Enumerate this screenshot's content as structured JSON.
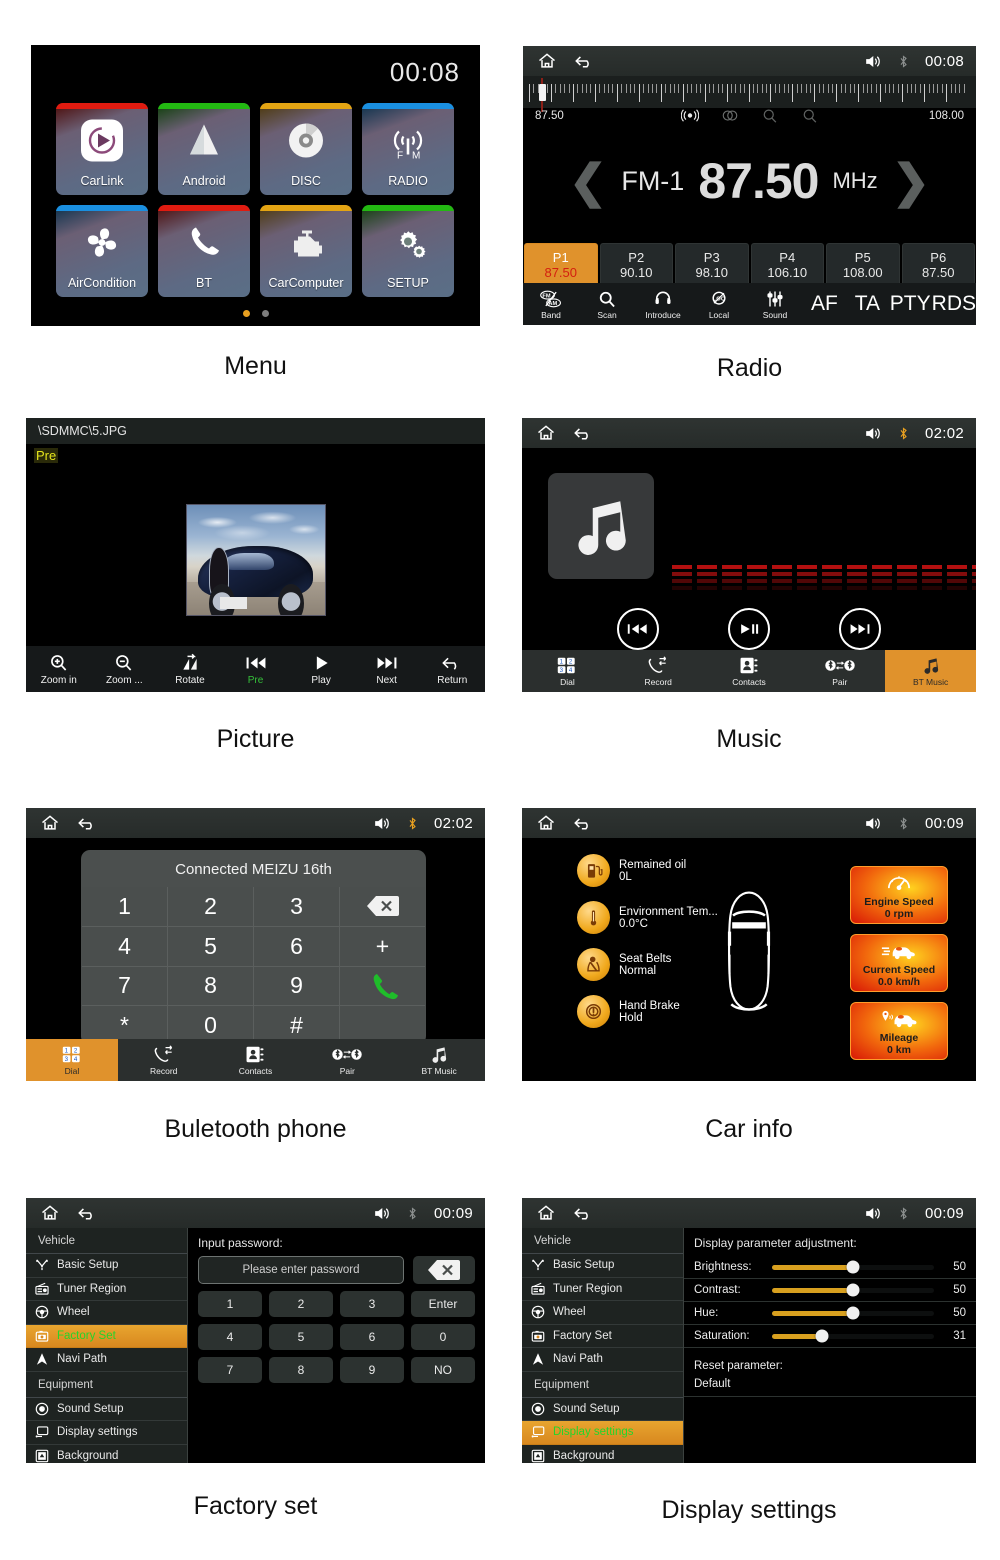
{
  "statusbar": {
    "home_icon": "home-icon",
    "back_icon": "back-arrow-icon",
    "volume_icon": "volume-icon",
    "bluetooth_icon": "bluetooth-icon"
  },
  "panels": [
    {
      "id": "menu",
      "caption": "Menu",
      "time": "00:08",
      "tiles": [
        {
          "label": "CarLink",
          "accent": "#e01b10",
          "icon": "carplay-icon"
        },
        {
          "label": "Android",
          "accent": "#23b812",
          "icon": "android-auto-icon"
        },
        {
          "label": "DISC",
          "accent": "#e3a413",
          "icon": "disc-icon"
        },
        {
          "label": "RADIO",
          "accent": "#1a8fe0",
          "icon": "radio-antenna-icon"
        },
        {
          "label": "AirCondition",
          "accent": "#1a8fe0",
          "icon": "fan-icon"
        },
        {
          "label": "BT",
          "accent": "#e01b10",
          "icon": "phone-handset-icon"
        },
        {
          "label": "CarComputer",
          "accent": "#e3a413",
          "icon": "engine-icon"
        },
        {
          "label": "SETUP",
          "accent": "#23b812",
          "icon": "gears-icon"
        }
      ],
      "page_dots": {
        "count": 2,
        "active": 0
      }
    },
    {
      "id": "radio",
      "caption": "Radio",
      "time": "00:08",
      "scale": {
        "min_label": "87.50",
        "max_label": "108.00",
        "cursor_pct": 4
      },
      "mini_icons": [
        "stereo-signal-icon",
        "stereo-icon",
        "scan-up-icon",
        "scan-down-icon"
      ],
      "band": "FM-1",
      "frequency": "87.50",
      "unit": "MHz",
      "prev_icon": "chevron-left-icon",
      "next_icon": "chevron-right-icon",
      "presets": [
        {
          "name": "P1",
          "freq": "87.50",
          "active": true
        },
        {
          "name": "P2",
          "freq": "90.10",
          "active": false
        },
        {
          "name": "P3",
          "freq": "98.10",
          "active": false
        },
        {
          "name": "P4",
          "freq": "106.10",
          "active": false
        },
        {
          "name": "P5",
          "freq": "108.00",
          "active": false
        },
        {
          "name": "P6",
          "freq": "87.50",
          "active": false
        }
      ],
      "bottom_icon_items": [
        {
          "label": "Band",
          "icon": "fm-am-icon"
        },
        {
          "label": "Scan",
          "icon": "search-icon"
        },
        {
          "label": "Introduce",
          "icon": "headphones-icon"
        },
        {
          "label": "Local",
          "icon": "loc-icon"
        },
        {
          "label": "Sound",
          "icon": "equalizer-icon"
        }
      ],
      "bottom_text_items": [
        "AF",
        "TA",
        "PTY",
        "RDS"
      ]
    },
    {
      "id": "picture",
      "caption": "Picture",
      "path": "\\SDMMC\\5.JPG",
      "overlay_label": "Pre",
      "toolbar": [
        {
          "label": "Zoom in",
          "icon": "zoom-in-icon",
          "selected": false
        },
        {
          "label": "Zoom ...",
          "icon": "zoom-out-icon",
          "selected": false
        },
        {
          "label": "Rotate",
          "icon": "rotate-icon",
          "selected": false
        },
        {
          "label": "Pre",
          "icon": "previous-icon",
          "selected": true
        },
        {
          "label": "Play",
          "icon": "play-icon",
          "selected": false
        },
        {
          "label": "Next",
          "icon": "next-icon",
          "selected": false
        },
        {
          "label": "Return",
          "icon": "return-arrow-icon",
          "selected": false
        }
      ]
    },
    {
      "id": "music",
      "caption": "Music",
      "time": "02:02",
      "album_icon": "music-note-icon",
      "equalizer": {
        "columns": 17,
        "segments": 4,
        "color": "#b31010"
      },
      "controls": [
        {
          "icon": "rewind-icon"
        },
        {
          "icon": "play-pause-icon"
        },
        {
          "icon": "fast-forward-icon"
        }
      ],
      "tabs": [
        {
          "label": "Dial",
          "icon": "keypad-icon",
          "active": false
        },
        {
          "label": "Record",
          "icon": "call-log-icon",
          "active": false
        },
        {
          "label": "Contacts",
          "icon": "contacts-book-icon",
          "active": false
        },
        {
          "label": "Pair",
          "icon": "bt-pair-icon",
          "active": false
        },
        {
          "label": "BT Music",
          "icon": "music-note-icon",
          "active": true
        }
      ]
    },
    {
      "id": "bluetooth",
      "caption": "Buletooth phone",
      "time": "02:02",
      "connected_title": "Connected MEIZU 16th",
      "keys": [
        "1",
        "2",
        "3",
        "backspace-icon",
        "4",
        "5",
        "6",
        "+",
        "7",
        "8",
        "9",
        "call-icon",
        "*",
        "0",
        "#",
        ""
      ],
      "tabs": [
        {
          "label": "Dial",
          "icon": "keypad-icon",
          "active": true
        },
        {
          "label": "Record",
          "icon": "call-log-icon",
          "active": false
        },
        {
          "label": "Contacts",
          "icon": "contacts-book-icon",
          "active": false
        },
        {
          "label": "Pair",
          "icon": "bt-pair-icon",
          "active": false
        },
        {
          "label": "BT Music",
          "icon": "music-note-icon",
          "active": false
        }
      ]
    },
    {
      "id": "carinfo",
      "caption": "Car info",
      "time": "00:09",
      "left_items": [
        {
          "key": "Remained oil",
          "value": "0L",
          "icon": "fuel-pump-icon"
        },
        {
          "key": "Environment Tem...",
          "value": "0.0°C",
          "icon": "thermometer-icon"
        },
        {
          "key": "Seat Belts",
          "value": "Normal",
          "icon": "seatbelt-icon"
        },
        {
          "key": "Hand Brake",
          "value": "Hold",
          "icon": "handbrake-icon"
        }
      ],
      "car_icon": "car-top-view-icon",
      "cards": [
        {
          "label": "Engine Speed",
          "value": "0 rpm",
          "icon": "tachometer-icon"
        },
        {
          "label": "Current Speed",
          "value": "0.0 km/h",
          "icon": "car-speed-icon"
        },
        {
          "label": "Mileage",
          "value": "0 km",
          "icon": "car-pin-icon"
        }
      ]
    },
    {
      "id": "factoryset",
      "caption": "Factory set",
      "time": "00:09",
      "sidebar": [
        {
          "type": "group",
          "label": "Vehicle"
        },
        {
          "type": "item",
          "label": "Basic Setup",
          "icon": "tools-icon",
          "selected": false
        },
        {
          "type": "item",
          "label": "Tuner Region",
          "icon": "radio-set-icon",
          "selected": false
        },
        {
          "type": "item",
          "label": "Wheel",
          "icon": "steering-icon",
          "selected": false
        },
        {
          "type": "item",
          "label": "Factory Set",
          "icon": "factory-icon",
          "selected": true
        },
        {
          "type": "item",
          "label": "Navi Path",
          "icon": "navigation-icon",
          "selected": false
        },
        {
          "type": "group",
          "label": "Equipment"
        },
        {
          "type": "item",
          "label": "Sound Setup",
          "icon": "speaker-icon",
          "selected": false
        },
        {
          "type": "item",
          "label": "Display settings",
          "icon": "monitor-icon",
          "selected": false
        },
        {
          "type": "item",
          "label": "Background",
          "icon": "wallpaper-icon",
          "selected": false
        }
      ],
      "main_head": "Input password:",
      "password_placeholder": "Please enter password",
      "password_value": "",
      "delete_icon": "backspace-icon",
      "keypad": [
        "1",
        "2",
        "3",
        "Enter",
        "4",
        "5",
        "6",
        "0",
        "7",
        "8",
        "9",
        "NO"
      ]
    },
    {
      "id": "display",
      "caption": "Display settings",
      "time": "00:09",
      "sidebar": [
        {
          "type": "group",
          "label": "Vehicle"
        },
        {
          "type": "item",
          "label": "Basic Setup",
          "icon": "tools-icon",
          "selected": false
        },
        {
          "type": "item",
          "label": "Tuner Region",
          "icon": "radio-set-icon",
          "selected": false
        },
        {
          "type": "item",
          "label": "Wheel",
          "icon": "steering-icon",
          "selected": false
        },
        {
          "type": "item",
          "label": "Factory Set",
          "icon": "factory-icon",
          "selected": false
        },
        {
          "type": "item",
          "label": "Navi Path",
          "icon": "navigation-icon",
          "selected": false
        },
        {
          "type": "group",
          "label": "Equipment"
        },
        {
          "type": "item",
          "label": "Sound Setup",
          "icon": "speaker-icon",
          "selected": false
        },
        {
          "type": "item",
          "label": "Display settings",
          "icon": "monitor-icon",
          "selected": true
        },
        {
          "type": "item",
          "label": "Background",
          "icon": "wallpaper-icon",
          "selected": false
        }
      ],
      "main_head": "Display parameter adjustment:",
      "sliders": [
        {
          "label": "Brightness:",
          "value": 50,
          "max": 100
        },
        {
          "label": "Contrast:",
          "value": 50,
          "max": 100
        },
        {
          "label": "Hue:",
          "value": 50,
          "max": 100
        },
        {
          "label": "Saturation:",
          "value": 31,
          "max": 100
        }
      ],
      "reset_label": "Reset parameter:",
      "reset_value": "Default"
    }
  ],
  "colors": {
    "accent_orange": "#e0922c",
    "selected_green": "#25d42b",
    "screen_bg": "#000000",
    "statusbar_bg": "#2f3432"
  }
}
